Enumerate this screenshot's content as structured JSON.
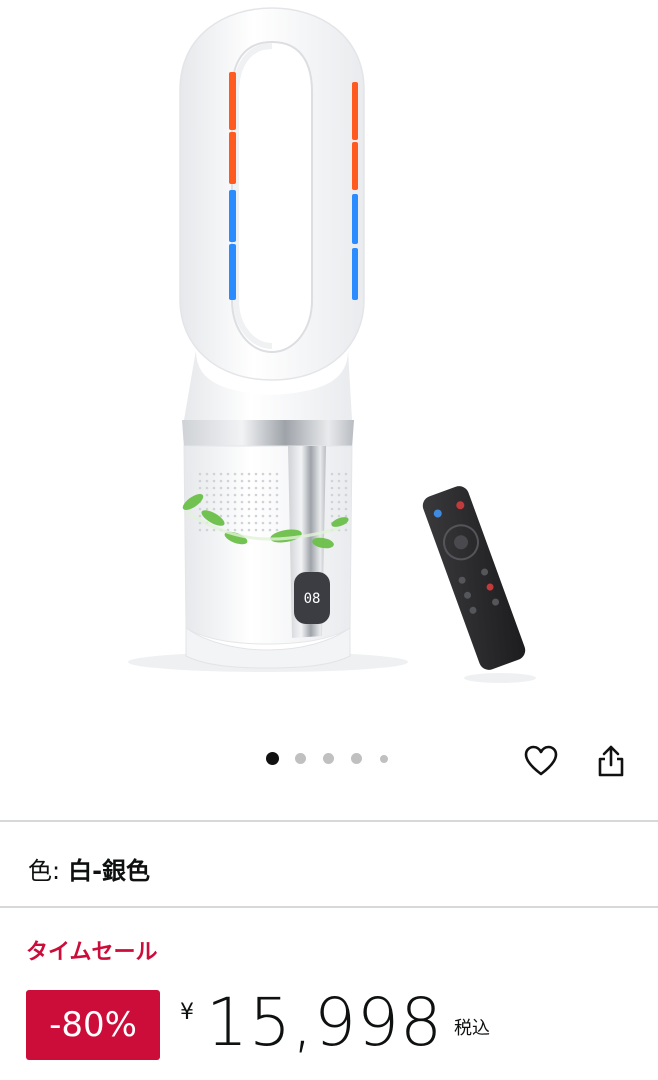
{
  "product_image": {
    "alt_icon": "bladeless-fan-image",
    "display_readout": "08",
    "colors": {
      "warm_strip": "#ff5a1f",
      "cool_strip": "#2b8cff",
      "leaf": "#6cc04a",
      "body": "#f6f7f9",
      "silver": "#a9adb3",
      "remote": "#2b2b2d"
    }
  },
  "carousel": {
    "count": 5,
    "active_index": 0
  },
  "actions": {
    "favorite_icon": "heart-icon",
    "share_icon": "share-icon"
  },
  "variant": {
    "label": "色:",
    "value": "白-銀色"
  },
  "deal": {
    "label": "タイムセール",
    "discount": "-80%",
    "currency": "¥",
    "price": "15,998",
    "tax_note": "税込",
    "accent_color": "#cc0c39"
  }
}
